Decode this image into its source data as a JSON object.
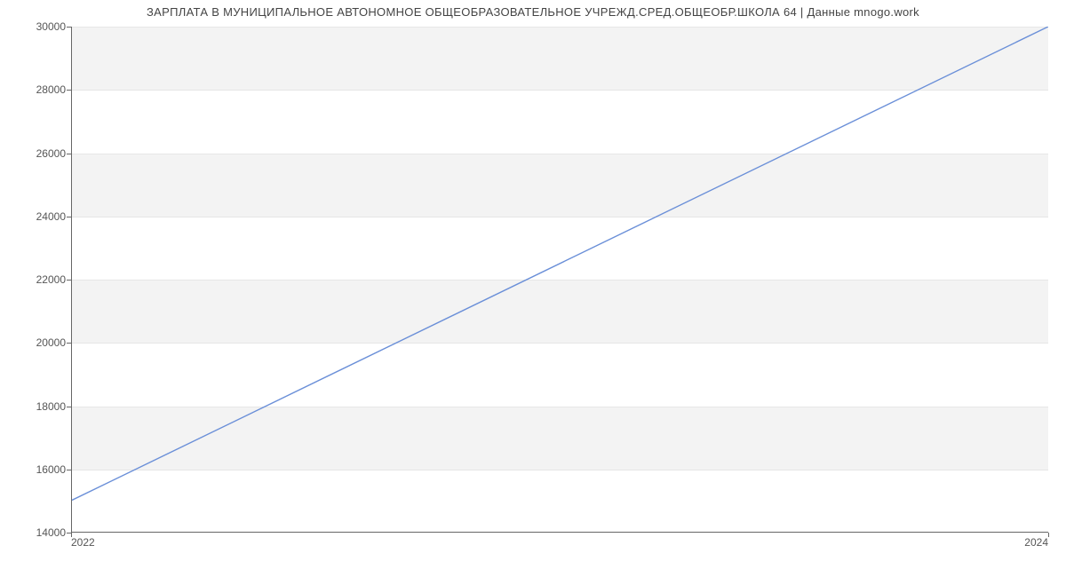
{
  "chart_data": {
    "type": "line",
    "title": "ЗАРПЛАТА В МУНИЦИПАЛЬНОЕ АВТОНОМНОЕ ОБЩЕОБРАЗОВАТЕЛЬНОЕ УЧРЕЖД.СРЕД.ОБЩЕОБР.ШКОЛА 64 | Данные mnogo.work",
    "xlabel": "",
    "ylabel": "",
    "x": [
      2022,
      2024
    ],
    "values": [
      15000,
      30000
    ],
    "xlim": [
      2022,
      2024
    ],
    "ylim": [
      14000,
      30000
    ],
    "y_ticks": [
      14000,
      16000,
      18000,
      20000,
      22000,
      24000,
      26000,
      28000,
      30000
    ],
    "x_ticks": [
      2022,
      2024
    ],
    "line_color": "#6a8fd8"
  }
}
